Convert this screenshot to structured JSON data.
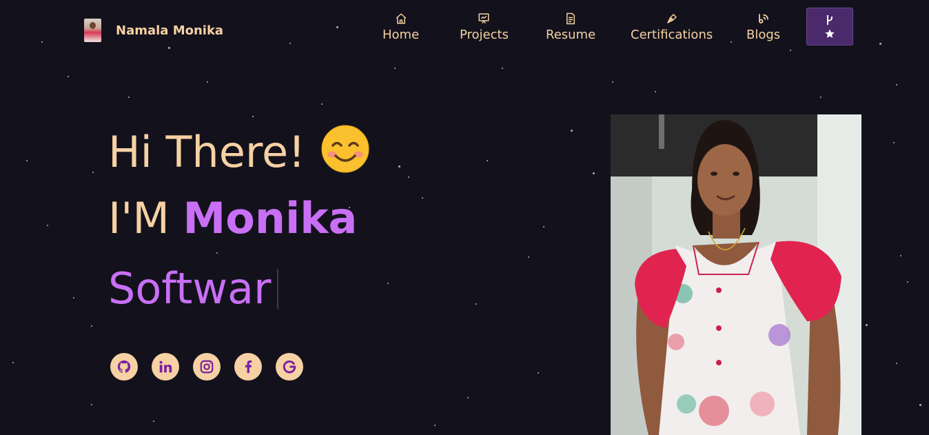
{
  "brand": {
    "name": "Namala Monika"
  },
  "nav": {
    "items": [
      {
        "label": "Home",
        "icon": "home-icon"
      },
      {
        "label": "Projects",
        "icon": "presentation-icon"
      },
      {
        "label": "Resume",
        "icon": "document-icon"
      },
      {
        "label": "Certifications",
        "icon": "pen-nib-icon"
      },
      {
        "label": "Blogs",
        "icon": "blog-icon"
      }
    ],
    "fork_button": {
      "icons": [
        "git-fork-icon",
        "star-icon"
      ]
    }
  },
  "hero": {
    "greeting": "Hi There!",
    "greeting_emoji": "smiling-face-icon",
    "intro_prefix": "I'M ",
    "intro_name": "Monika",
    "typed_text": "Softwar"
  },
  "socials": [
    {
      "icon": "github-icon"
    },
    {
      "icon": "linkedin-icon"
    },
    {
      "icon": "instagram-icon"
    },
    {
      "icon": "facebook-icon"
    },
    {
      "icon": "google-icon"
    }
  ],
  "colors": {
    "background": "#13121c",
    "accent_text": "#f6d1a3",
    "highlight": "#c96ff5",
    "button_bg": "#4b2a6b",
    "social_icon": "#7a1fa2"
  }
}
